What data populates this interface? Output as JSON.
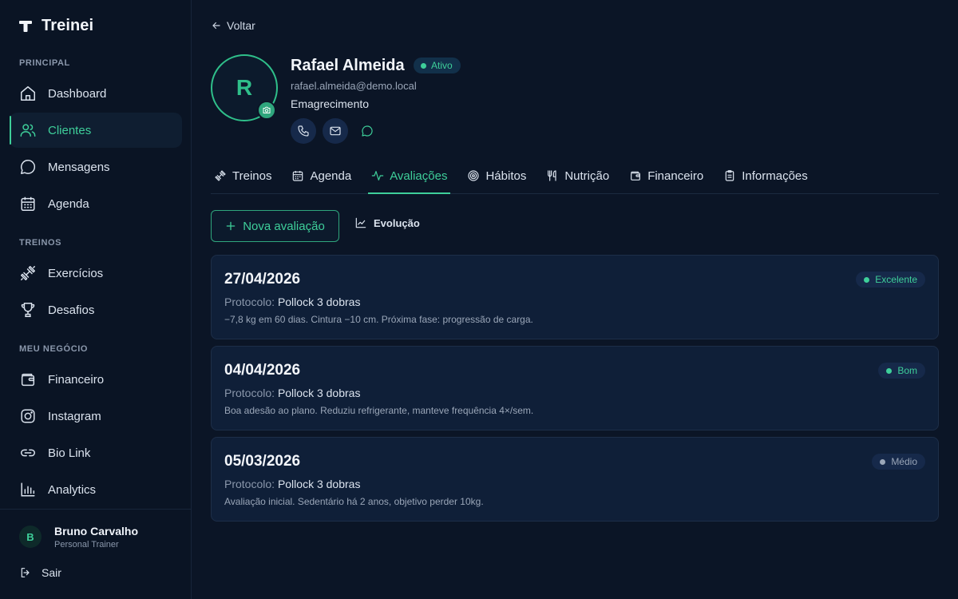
{
  "brand": {
    "name": "Treinei"
  },
  "sidebar": {
    "sections": [
      {
        "label": "PRINCIPAL"
      },
      {
        "label": "TREINOS"
      },
      {
        "label": "MEU NEGÓCIO"
      }
    ],
    "items": [
      {
        "label": "Dashboard",
        "icon": "home-icon"
      },
      {
        "label": "Clientes",
        "icon": "users-icon",
        "active": true
      },
      {
        "label": "Mensagens",
        "icon": "message-icon"
      },
      {
        "label": "Agenda",
        "icon": "calendar-icon"
      },
      {
        "label": "Exercícios",
        "icon": "dumbbell-icon"
      },
      {
        "label": "Desafios",
        "icon": "trophy-icon"
      },
      {
        "label": "Financeiro",
        "icon": "wallet-icon"
      },
      {
        "label": "Instagram",
        "icon": "instagram-icon"
      },
      {
        "label": "Bio Link",
        "icon": "link-icon"
      },
      {
        "label": "Analytics",
        "icon": "chart-icon"
      }
    ],
    "user": {
      "initial": "B",
      "name": "Bruno Carvalho",
      "role": "Personal Trainer"
    },
    "logout_label": "Sair"
  },
  "back_label": "Voltar",
  "client": {
    "initial": "R",
    "name": "Rafael Almeida",
    "status": "Ativo",
    "email": "rafael.almeida@demo.local",
    "goal": "Emagrecimento"
  },
  "tabs": [
    {
      "label": "Treinos",
      "icon": "dumbbell-icon"
    },
    {
      "label": "Agenda",
      "icon": "calendar-icon"
    },
    {
      "label": "Avaliações",
      "icon": "activity-icon",
      "active": true
    },
    {
      "label": "Hábitos",
      "icon": "target-icon"
    },
    {
      "label": "Nutrição",
      "icon": "utensils-icon"
    },
    {
      "label": "Financeiro",
      "icon": "wallet-icon"
    },
    {
      "label": "Informações",
      "icon": "clipboard-icon"
    }
  ],
  "actions": {
    "new_label": "Nova avaliação",
    "evolution_label": "Evolução"
  },
  "colors": {
    "accent": "#3ecf9a",
    "muted_badge": "#9aa6b8"
  },
  "assessments": [
    {
      "date": "27/04/2026",
      "protocol_label": "Protocolo:",
      "protocol": "Pollock 3 dobras",
      "note": "−7,8 kg em 60 dias. Cintura −10 cm. Próxima fase: progressão de carga.",
      "rating": "Excelente",
      "rating_color": "#3ecf9a"
    },
    {
      "date": "04/04/2026",
      "protocol_label": "Protocolo:",
      "protocol": "Pollock 3 dobras",
      "note": "Boa adesão ao plano. Reduziu refrigerante, manteve frequência 4×/sem.",
      "rating": "Bom",
      "rating_color": "#3ecf9a"
    },
    {
      "date": "05/03/2026",
      "protocol_label": "Protocolo:",
      "protocol": "Pollock 3 dobras",
      "note": "Avaliação inicial. Sedentário há 2 anos, objetivo perder 10kg.",
      "rating": "Médio",
      "rating_color": "#9aa6b8"
    }
  ]
}
